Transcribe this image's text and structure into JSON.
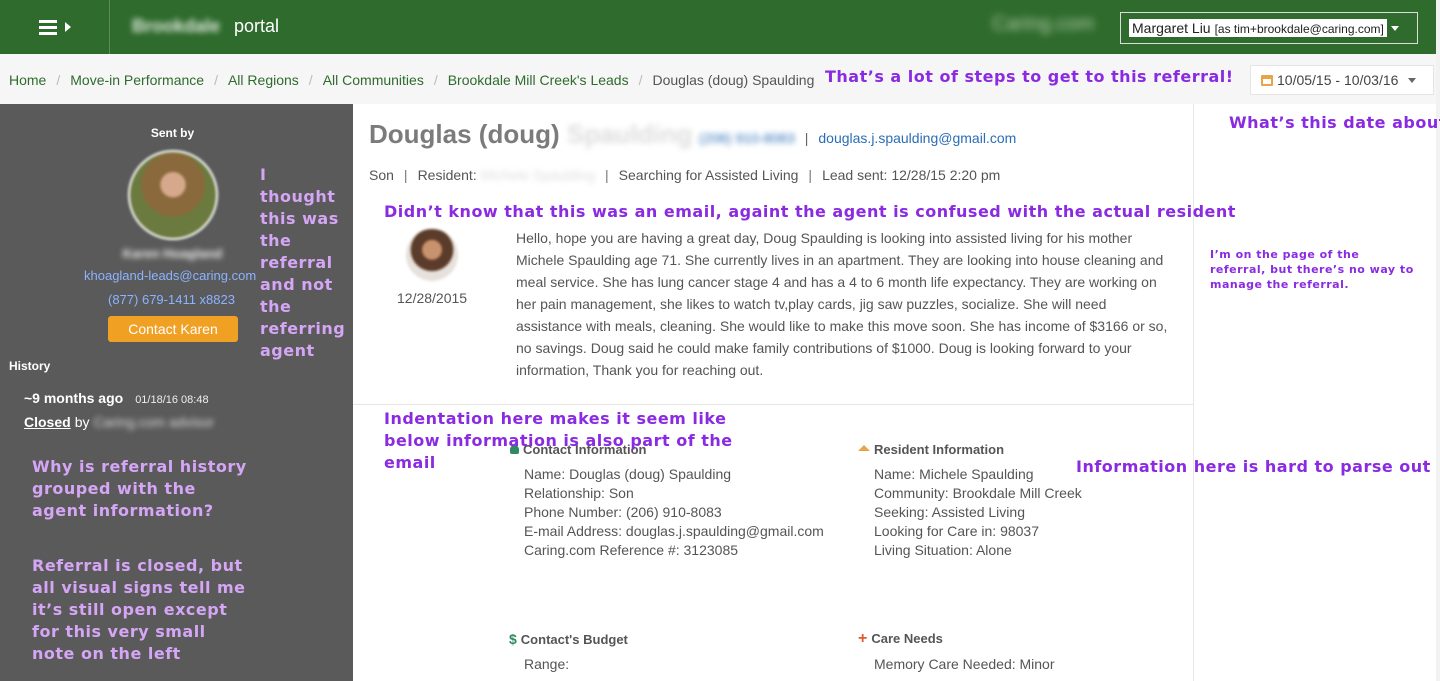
{
  "header": {
    "brand_name": "Brookdale",
    "brand_suffix": "portal",
    "partner_logo": "Caring.com",
    "user_name": "Margaret Liu",
    "user_as": "[as tim+brookdale@caring.com]"
  },
  "breadcrumb": {
    "items": [
      "Home",
      "Move-in Performance",
      "All Regions",
      "All Communities",
      "Brookdale Mill Creek's Leads"
    ],
    "current": "Douglas (doug) Spaulding",
    "separator": "/"
  },
  "date_range": "10/05/15 - 10/03/16",
  "agent": {
    "sent_by_label": "Sent by",
    "name": "Karen Hoagland",
    "email": "khoagland-leads@caring.com",
    "phone": "(877) 679-1411 x8823",
    "contact_button": "Contact Karen"
  },
  "history": {
    "title": "History",
    "ago": "~9 months ago",
    "timestamp": "01/18/16 08:48",
    "status": "Closed",
    "by_label": "by",
    "by_name": "Caring.com advisor"
  },
  "lead": {
    "name": "Douglas (doug)",
    "name_blurred": "Spaulding",
    "phone": "(206) 910-8083",
    "email": "douglas.j.spaulding@gmail.com",
    "relationship": "Son",
    "resident_label": "Resident:",
    "resident_name": "Michele Spaulding",
    "searching": "Searching for Assisted Living",
    "lead_sent": "Lead sent: 12/28/15 2:20 pm",
    "separator": "|"
  },
  "message": {
    "date": "12/28/2015",
    "body": "Hello, hope you are having a great day, Doug Spaulding is looking into assisted living for his mother Michele Spaulding age 71. She currently lives in an apartment. They are looking into house cleaning and meal service. She has lung cancer stage 4 and has a 4 to 6 month life expectancy. They are working on her pain management, she likes to watch tv,play cards, jig saw puzzles, socialize. She will need assistance with meals, cleaning. She would like to make this move soon. She has income of $3166 or so, no savings. Doug said he could make family contributions of $1000. Doug is looking forward to your information, Thank you for reaching out."
  },
  "contact_info": {
    "title": "Contact Information",
    "lines": [
      "Name: Douglas (doug) Spaulding",
      "Relationship: Son",
      "Phone Number: (206) 910-8083",
      "E-mail Address: douglas.j.spaulding@gmail.com",
      "Caring.com Reference #: 3123085"
    ]
  },
  "resident_info": {
    "title": "Resident Information",
    "lines": [
      "Name: Michele Spaulding",
      "Community: Brookdale Mill Creek",
      "Seeking: Assisted Living",
      "Looking for Care in: 98037",
      "Living Situation: Alone"
    ]
  },
  "budget": {
    "title": "Contact's Budget",
    "lines": [
      "Range:"
    ]
  },
  "care_needs": {
    "title": "Care Needs",
    "lines": [
      "Memory Care Needed: Minor"
    ]
  },
  "annotations": {
    "steps": "That’s a lot of steps to get to this referral!",
    "date_about": "What’s this date about?",
    "thought_referral": "I thought this was the referral and not the referring agent",
    "email_confusion": "Didn’t know that this was an email, againt the agent is confused with the actual resident",
    "manage": "I’m on the page of the referral, but there’s no way to manage the referral.",
    "indentation": "Indentation here makes it seem like below information is also part of the email",
    "hard_parse": "Information here is hard to parse out",
    "history_grouped": "Why is referral history grouped with the agent information?",
    "closed_signs": "Referral is closed, but all visual signs tell me it’s still open except for this very small note on the left"
  },
  "colors": {
    "header_green": "#2f6b2c",
    "link_green": "#2f6b2c",
    "sidebar_gray": "#5a5a5a",
    "contact_button": "#f0a022",
    "annotation_purple": "#8a2be2",
    "annotation_light": "#d5a6f5"
  },
  "icons": [
    "menu-icon",
    "chevron-right-icon",
    "calendar-icon",
    "chevron-down-icon",
    "user-icon",
    "home-icon",
    "dollar-icon",
    "plus-icon"
  ]
}
